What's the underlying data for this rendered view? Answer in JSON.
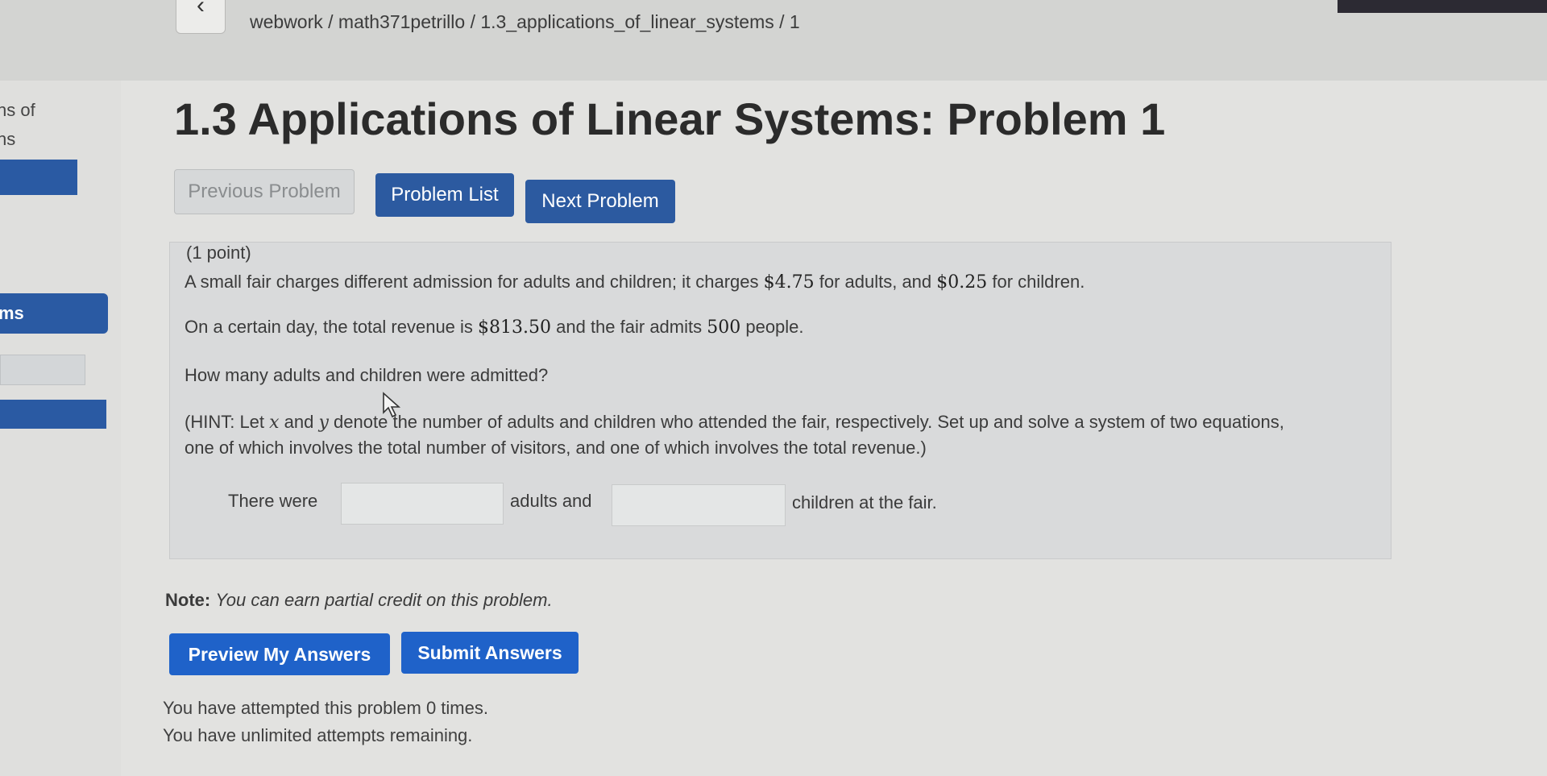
{
  "header": {
    "back_icon": "chevron-left-icon",
    "breadcrumb": "webwork / math371petrillo / 1.3_applications_of_linear_systems / 1"
  },
  "sidebar": {
    "fragment_1": "ns of",
    "fragment_2": "ns",
    "fragment_3": "ms"
  },
  "page": {
    "title": "1.3 Applications of Linear Systems: Problem 1"
  },
  "nav": {
    "previous": "Previous Problem",
    "list": "Problem List",
    "next": "Next Problem"
  },
  "problem": {
    "points": "(1 point)",
    "line1_pre": "A small fair charges different admission for adults and children; it charges ",
    "adult_price": "$4.75",
    "line1_mid": " for adults, and ",
    "child_price": "$0.25",
    "line1_post": " for children.",
    "line2_pre": "On a certain day, the total revenue is ",
    "revenue": "$813.50",
    "line2_mid": " and the fair admits ",
    "people": "500",
    "line2_post": " people.",
    "question": "How many adults and children were admitted?",
    "hint_pre": "(HINT: Let ",
    "var_x": "x",
    "hint_and": " and ",
    "var_y": "y",
    "hint_post": " denote the number of adults and children who attended the fair, respectively. Set up and solve a system of two equations,",
    "hint_line2": "one of which involves the total number of visitors, and one of which involves the total revenue.)",
    "answer_pre": "There were",
    "answer_mid": "adults and",
    "answer_post": "children at the fair.",
    "answer_adults_value": "",
    "answer_children_value": ""
  },
  "note": {
    "label": "Note:",
    "text": "You can earn partial credit on this problem."
  },
  "actions": {
    "preview": "Preview My Answers",
    "submit": "Submit Answers"
  },
  "status": {
    "attempted": "You have attempted this problem 0 times.",
    "remaining": "You have unlimited attempts remaining."
  },
  "colors": {
    "primary_button": "#2c5aa0",
    "action_button": "#1f62c9",
    "background": "#e2e2e0"
  }
}
